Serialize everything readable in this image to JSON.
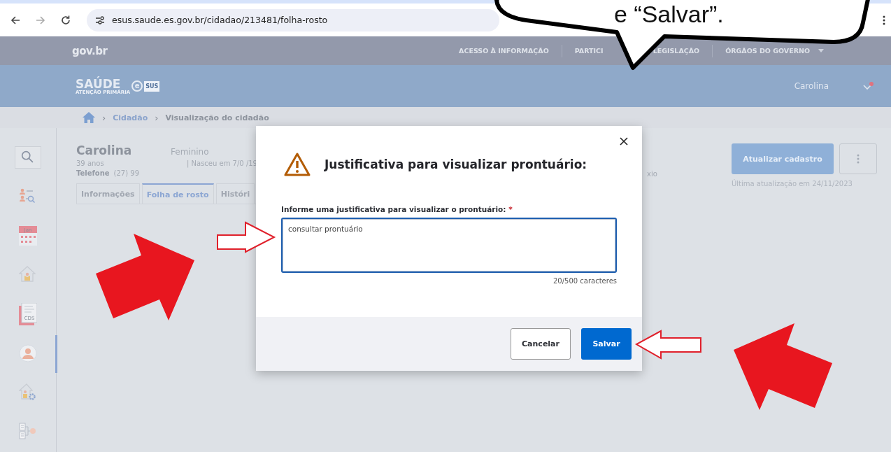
{
  "browser": {
    "url": "esus.saude.es.gov.br/cidadao/213481/folha-rosto"
  },
  "govbr_bar": {
    "logo": "gov.br",
    "links": [
      {
        "label": "ACESSO À INFORMAÇÃO"
      },
      {
        "label": "PARTICI"
      },
      {
        "label": "LEGISLAÇÃO"
      },
      {
        "label": "ÓRGÃOS DO GOVERNO"
      }
    ]
  },
  "app_header": {
    "logo_title": "SAÚDE",
    "logo_subtitle": "ATENÇÃO PRIMÁRIA",
    "logo_e": "e",
    "logo_badge": "SUS",
    "user": "Carolina"
  },
  "breadcrumb": [
    {
      "separator": "›",
      "label": "Cidadão",
      "current": false
    },
    {
      "separator": "›",
      "label": "Visualização do cidadão",
      "current": true
    }
  ],
  "sidebar": {
    "items": [
      {
        "kind": "search",
        "selected": false
      },
      {
        "kind": "people-search",
        "selected": false
      },
      {
        "kind": "calendar",
        "label": "Jan",
        "selected": false
      },
      {
        "kind": "house-person",
        "selected": false
      },
      {
        "kind": "document",
        "label": "CDS",
        "selected": false
      },
      {
        "kind": "person",
        "selected": true
      },
      {
        "kind": "house-gear",
        "selected": false
      },
      {
        "kind": "document-person",
        "selected": false
      }
    ]
  },
  "patient": {
    "name": "Carolina",
    "sex": "Feminino",
    "age": "39 anos",
    "birth": "| Nasceu em  7/0  /19",
    "phone_label": "Telefone",
    "phone": "(27) 99",
    "extra": "xio"
  },
  "tabs": [
    {
      "label": "Informações",
      "selected": false
    },
    {
      "label": "Folha de rosto",
      "selected": true
    },
    {
      "label": "Históri",
      "selected": false
    }
  ],
  "update": {
    "button": "Atualizar cadastro",
    "last_update": "Última atualização em 24/11/2023"
  },
  "modal": {
    "title": "Justificativa para visualizar prontuário:",
    "field_label": "Informe uma justificativa para visualizar o prontuário:",
    "required_mark": "*",
    "value": "consultar prontuário",
    "counter": "20/500 caracteres",
    "buttons": [
      {
        "label": "Cancelar",
        "kind": "secondary"
      },
      {
        "label": "Salvar",
        "kind": "primary"
      }
    ]
  },
  "annotation": {
    "text": "e “Salvar”."
  }
}
